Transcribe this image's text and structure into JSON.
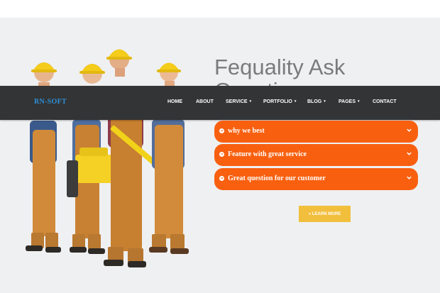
{
  "brand": {
    "logo_text": "RN-SOFT",
    "accent": "#2f8fd8"
  },
  "nav": {
    "items": [
      {
        "label": "HOME",
        "dropdown": false
      },
      {
        "label": "ABOUT",
        "dropdown": false
      },
      {
        "label": "SERVICE",
        "dropdown": true
      },
      {
        "label": "PORTFOLIO",
        "dropdown": true
      },
      {
        "label": "BLOG",
        "dropdown": true
      },
      {
        "label": "PAGES",
        "dropdown": true
      },
      {
        "label": "CONTACT",
        "dropdown": false
      }
    ],
    "caret_glyph": "▾"
  },
  "faq": {
    "heading": "Fequality Ask Question",
    "items": [
      {
        "label": "why we best",
        "icon": "play-circle-icon"
      },
      {
        "label": "Feature with great service",
        "icon": "play-circle-icon"
      },
      {
        "label": "Great question for our customer",
        "icon": "play-circle-icon"
      }
    ],
    "accent": "#f86010",
    "button_label": "» LEARN MORE",
    "button_color": "#f2bf3d"
  },
  "hero_image": {
    "icon": "construction-workers-illustration"
  }
}
